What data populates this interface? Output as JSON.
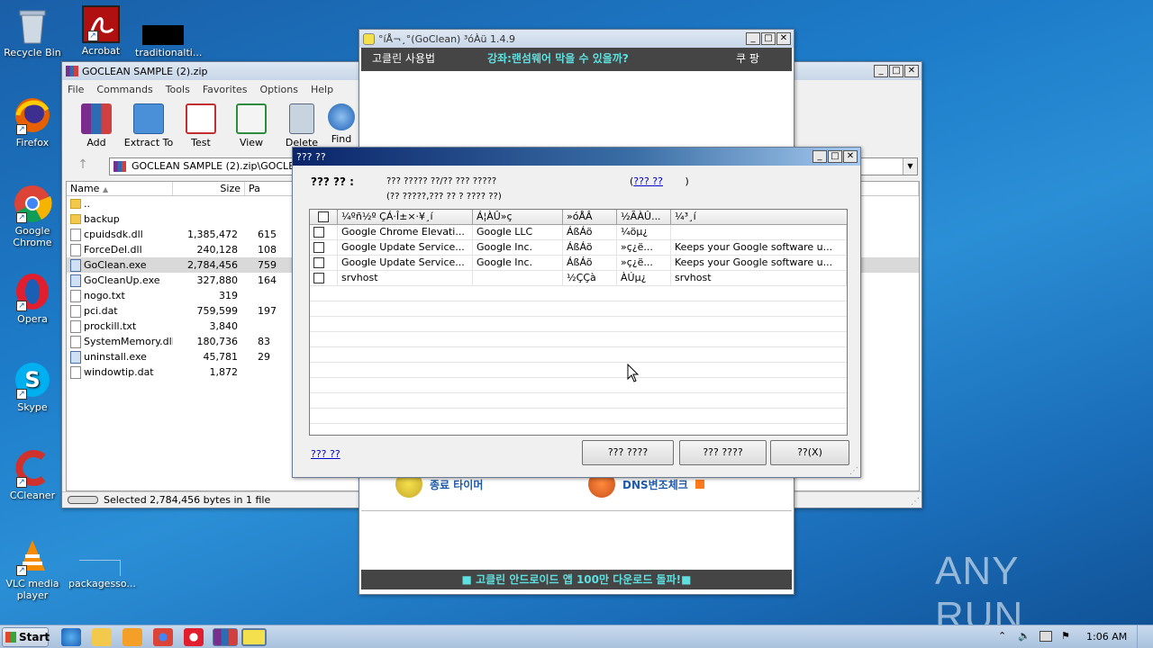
{
  "desktop": {
    "icons": [
      {
        "label": "Recycle Bin"
      },
      {
        "label": "Acrobat"
      },
      {
        "label": "traditionalti..."
      },
      {
        "label": "Firefox"
      },
      {
        "label": "Google Chrome"
      },
      {
        "label": "Opera"
      },
      {
        "label": "Skype"
      },
      {
        "label": "CCleaner"
      },
      {
        "label": "VLC media player"
      },
      {
        "label": "packagesso..."
      }
    ],
    "watermark": "ANY RUN"
  },
  "winrar": {
    "title": "GOCLEAN SAMPLE (2).zip",
    "menu": [
      "File",
      "Commands",
      "Tools",
      "Favorites",
      "Options",
      "Help"
    ],
    "toolbar": [
      "Add",
      "Extract To",
      "Test",
      "View",
      "Delete",
      "Find"
    ],
    "path": "GOCLEAN SAMPLE (2).zip\\GOCLEAN",
    "columns": {
      "name": "Name",
      "size": "Size",
      "packed": "Pa"
    },
    "files": [
      {
        "name": "..",
        "size": "",
        "packed": ""
      },
      {
        "name": "backup",
        "size": "",
        "packed": ""
      },
      {
        "name": "cpuidsdk.dll",
        "size": "1,385,472",
        "packed": "615"
      },
      {
        "name": "ForceDel.dll",
        "size": "240,128",
        "packed": "108"
      },
      {
        "name": "GoClean.exe",
        "size": "2,784,456",
        "packed": "759"
      },
      {
        "name": "GoCleanUp.exe",
        "size": "327,880",
        "packed": "164"
      },
      {
        "name": "nogo.txt",
        "size": "319",
        "packed": ""
      },
      {
        "name": "pci.dat",
        "size": "759,599",
        "packed": "197"
      },
      {
        "name": "prockill.txt",
        "size": "3,840",
        "packed": ""
      },
      {
        "name": "SystemMemory.dll",
        "size": "180,736",
        "packed": "83"
      },
      {
        "name": "uninstall.exe",
        "size": "45,781",
        "packed": "29"
      },
      {
        "name": "windowtip.dat",
        "size": "1,872",
        "packed": ""
      }
    ],
    "status": "Selected 2,784,456 bytes in 1 file"
  },
  "goclean": {
    "title": "°íÅ¬¸°(GoClean) ³óÀü 1.4.9",
    "nav_left": "고클린 사용법",
    "nav_center": "강좌:랜섬웨어 막을 수 있을까?",
    "nav_right": "쿠 팡",
    "feature_left": "종료 타이머",
    "feature_right": "DNS변조체크",
    "banner": "■ 고클린 안드로이드 앱 100만 다운로드 돌파!■"
  },
  "dialog": {
    "title": "??? ??",
    "label": "??? ?? :",
    "desc1": "??? ????? ??/?? ??? ?????",
    "desc2": "(?? ?????,??? ?? ? ???? ??)",
    "link_top": "??? ??",
    "link_bottom": "??? ??",
    "columns": [
      "¼­ºñ½º ÇÁ·Î±×·¥¸í",
      "Á¦ÀÛ»ç",
      "»óÅÂ",
      "½ÃÀÛ...",
      "¼³¸í"
    ],
    "rows": [
      {
        "name": "Google Chrome Elevati...",
        "vendor": "Google LLC",
        "state": "ÁßÁö",
        "start": "¼öµ¿",
        "desc": ""
      },
      {
        "name": "Google Update Service...",
        "vendor": "Google Inc.",
        "state": "ÁßÁö",
        "start": "»ç¿ë...",
        "desc": "Keeps your Google software u..."
      },
      {
        "name": "Google Update Service...",
        "vendor": "Google Inc.",
        "state": "ÁßÁö",
        "start": "»ç¿ë...",
        "desc": "Keeps your Google software u..."
      },
      {
        "name": "srvhost",
        "vendor": "",
        "state": "½ÇÇà",
        "start": "ÀÚµ¿",
        "desc": "srvhost"
      }
    ],
    "btn1": "??? ????",
    "btn2": "??? ????",
    "btn3": "??(X)"
  },
  "taskbar": {
    "start": "Start",
    "clock": "1:06 AM"
  }
}
